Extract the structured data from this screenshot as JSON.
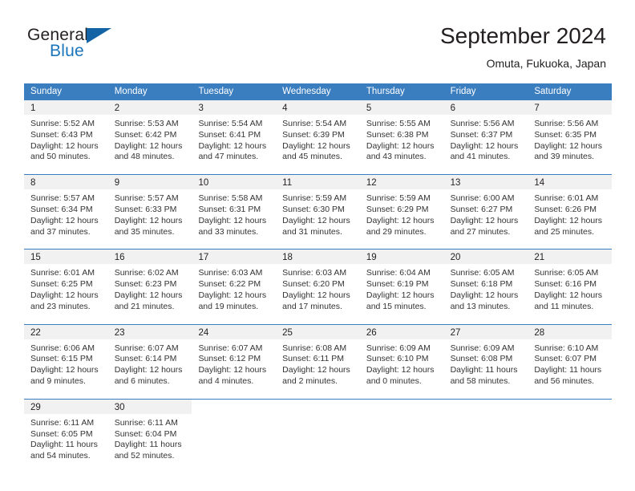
{
  "brand": {
    "word_one": "General",
    "word_two": "Blue",
    "icon": "triangle-logo-icon"
  },
  "header": {
    "month_title": "September 2024",
    "location": "Omuta, Fukuoka, Japan"
  },
  "colors": {
    "header_blue": "#3b7ec0",
    "brand_blue": "#1b75bb",
    "day_strip_gray": "#f1f1f1",
    "text": "#231f20"
  },
  "weekdays": [
    "Sunday",
    "Monday",
    "Tuesday",
    "Wednesday",
    "Thursday",
    "Friday",
    "Saturday"
  ],
  "labels": {
    "sunrise_prefix": "Sunrise:",
    "sunset_prefix": "Sunset:",
    "daylight_prefix": "Daylight:"
  },
  "weeks": [
    [
      {
        "day": "1",
        "sunrise": "Sunrise: 5:52 AM",
        "sunset": "Sunset: 6:43 PM",
        "daylight": "Daylight: 12 hours and 50 minutes."
      },
      {
        "day": "2",
        "sunrise": "Sunrise: 5:53 AM",
        "sunset": "Sunset: 6:42 PM",
        "daylight": "Daylight: 12 hours and 48 minutes."
      },
      {
        "day": "3",
        "sunrise": "Sunrise: 5:54 AM",
        "sunset": "Sunset: 6:41 PM",
        "daylight": "Daylight: 12 hours and 47 minutes."
      },
      {
        "day": "4",
        "sunrise": "Sunrise: 5:54 AM",
        "sunset": "Sunset: 6:39 PM",
        "daylight": "Daylight: 12 hours and 45 minutes."
      },
      {
        "day": "5",
        "sunrise": "Sunrise: 5:55 AM",
        "sunset": "Sunset: 6:38 PM",
        "daylight": "Daylight: 12 hours and 43 minutes."
      },
      {
        "day": "6",
        "sunrise": "Sunrise: 5:56 AM",
        "sunset": "Sunset: 6:37 PM",
        "daylight": "Daylight: 12 hours and 41 minutes."
      },
      {
        "day": "7",
        "sunrise": "Sunrise: 5:56 AM",
        "sunset": "Sunset: 6:35 PM",
        "daylight": "Daylight: 12 hours and 39 minutes."
      }
    ],
    [
      {
        "day": "8",
        "sunrise": "Sunrise: 5:57 AM",
        "sunset": "Sunset: 6:34 PM",
        "daylight": "Daylight: 12 hours and 37 minutes."
      },
      {
        "day": "9",
        "sunrise": "Sunrise: 5:57 AM",
        "sunset": "Sunset: 6:33 PM",
        "daylight": "Daylight: 12 hours and 35 minutes."
      },
      {
        "day": "10",
        "sunrise": "Sunrise: 5:58 AM",
        "sunset": "Sunset: 6:31 PM",
        "daylight": "Daylight: 12 hours and 33 minutes."
      },
      {
        "day": "11",
        "sunrise": "Sunrise: 5:59 AM",
        "sunset": "Sunset: 6:30 PM",
        "daylight": "Daylight: 12 hours and 31 minutes."
      },
      {
        "day": "12",
        "sunrise": "Sunrise: 5:59 AM",
        "sunset": "Sunset: 6:29 PM",
        "daylight": "Daylight: 12 hours and 29 minutes."
      },
      {
        "day": "13",
        "sunrise": "Sunrise: 6:00 AM",
        "sunset": "Sunset: 6:27 PM",
        "daylight": "Daylight: 12 hours and 27 minutes."
      },
      {
        "day": "14",
        "sunrise": "Sunrise: 6:01 AM",
        "sunset": "Sunset: 6:26 PM",
        "daylight": "Daylight: 12 hours and 25 minutes."
      }
    ],
    [
      {
        "day": "15",
        "sunrise": "Sunrise: 6:01 AM",
        "sunset": "Sunset: 6:25 PM",
        "daylight": "Daylight: 12 hours and 23 minutes."
      },
      {
        "day": "16",
        "sunrise": "Sunrise: 6:02 AM",
        "sunset": "Sunset: 6:23 PM",
        "daylight": "Daylight: 12 hours and 21 minutes."
      },
      {
        "day": "17",
        "sunrise": "Sunrise: 6:03 AM",
        "sunset": "Sunset: 6:22 PM",
        "daylight": "Daylight: 12 hours and 19 minutes."
      },
      {
        "day": "18",
        "sunrise": "Sunrise: 6:03 AM",
        "sunset": "Sunset: 6:20 PM",
        "daylight": "Daylight: 12 hours and 17 minutes."
      },
      {
        "day": "19",
        "sunrise": "Sunrise: 6:04 AM",
        "sunset": "Sunset: 6:19 PM",
        "daylight": "Daylight: 12 hours and 15 minutes."
      },
      {
        "day": "20",
        "sunrise": "Sunrise: 6:05 AM",
        "sunset": "Sunset: 6:18 PM",
        "daylight": "Daylight: 12 hours and 13 minutes."
      },
      {
        "day": "21",
        "sunrise": "Sunrise: 6:05 AM",
        "sunset": "Sunset: 6:16 PM",
        "daylight": "Daylight: 12 hours and 11 minutes."
      }
    ],
    [
      {
        "day": "22",
        "sunrise": "Sunrise: 6:06 AM",
        "sunset": "Sunset: 6:15 PM",
        "daylight": "Daylight: 12 hours and 9 minutes."
      },
      {
        "day": "23",
        "sunrise": "Sunrise: 6:07 AM",
        "sunset": "Sunset: 6:14 PM",
        "daylight": "Daylight: 12 hours and 6 minutes."
      },
      {
        "day": "24",
        "sunrise": "Sunrise: 6:07 AM",
        "sunset": "Sunset: 6:12 PM",
        "daylight": "Daylight: 12 hours and 4 minutes."
      },
      {
        "day": "25",
        "sunrise": "Sunrise: 6:08 AM",
        "sunset": "Sunset: 6:11 PM",
        "daylight": "Daylight: 12 hours and 2 minutes."
      },
      {
        "day": "26",
        "sunrise": "Sunrise: 6:09 AM",
        "sunset": "Sunset: 6:10 PM",
        "daylight": "Daylight: 12 hours and 0 minutes."
      },
      {
        "day": "27",
        "sunrise": "Sunrise: 6:09 AM",
        "sunset": "Sunset: 6:08 PM",
        "daylight": "Daylight: 11 hours and 58 minutes."
      },
      {
        "day": "28",
        "sunrise": "Sunrise: 6:10 AM",
        "sunset": "Sunset: 6:07 PM",
        "daylight": "Daylight: 11 hours and 56 minutes."
      }
    ],
    [
      {
        "day": "29",
        "sunrise": "Sunrise: 6:11 AM",
        "sunset": "Sunset: 6:05 PM",
        "daylight": "Daylight: 11 hours and 54 minutes."
      },
      {
        "day": "30",
        "sunrise": "Sunrise: 6:11 AM",
        "sunset": "Sunset: 6:04 PM",
        "daylight": "Daylight: 11 hours and 52 minutes."
      },
      {
        "day": "",
        "sunrise": "",
        "sunset": "",
        "daylight": ""
      },
      {
        "day": "",
        "sunrise": "",
        "sunset": "",
        "daylight": ""
      },
      {
        "day": "",
        "sunrise": "",
        "sunset": "",
        "daylight": ""
      },
      {
        "day": "",
        "sunrise": "",
        "sunset": "",
        "daylight": ""
      },
      {
        "day": "",
        "sunrise": "",
        "sunset": "",
        "daylight": ""
      }
    ]
  ]
}
